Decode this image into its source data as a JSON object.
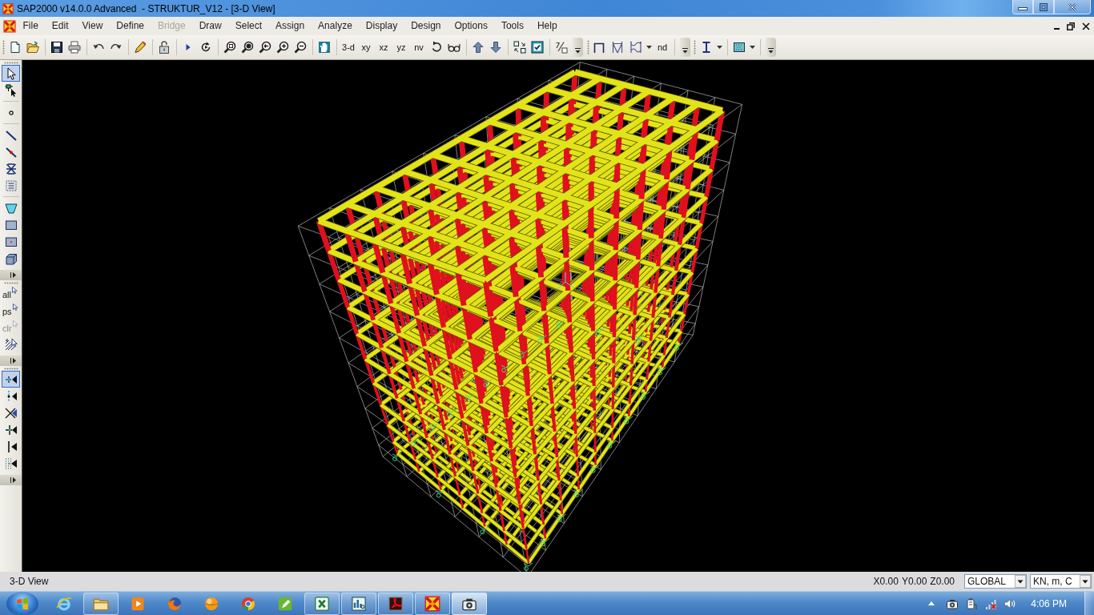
{
  "window": {
    "title": "SAP2000 v14.0.0 Advanced  - STRUKTUR_V12 - [3-D View]"
  },
  "menu": [
    {
      "label": "File",
      "disabled": false
    },
    {
      "label": "Edit",
      "disabled": false
    },
    {
      "label": "View",
      "disabled": false
    },
    {
      "label": "Define",
      "disabled": false
    },
    {
      "label": "Bridge",
      "disabled": true
    },
    {
      "label": "Draw",
      "disabled": false
    },
    {
      "label": "Select",
      "disabled": false
    },
    {
      "label": "Assign",
      "disabled": false
    },
    {
      "label": "Analyze",
      "disabled": false
    },
    {
      "label": "Display",
      "disabled": false
    },
    {
      "label": "Design",
      "disabled": false
    },
    {
      "label": "Options",
      "disabled": false
    },
    {
      "label": "Tools",
      "disabled": false
    },
    {
      "label": "Help",
      "disabled": false
    }
  ],
  "standard_toolbar": {
    "view_buttons": [
      {
        "label": "3-d"
      },
      {
        "label": "xy"
      },
      {
        "label": "xz"
      },
      {
        "label": "yz"
      },
      {
        "label": "nv"
      }
    ]
  },
  "frame_toolbar": {
    "text_buttons": [
      {
        "label": "nd"
      }
    ]
  },
  "left_toolbar": {
    "select_tools": [
      {
        "selected": true
      },
      {
        "selected": false
      }
    ],
    "select_buttons": [
      {
        "label": "all",
        "disabled": false
      },
      {
        "label": "ps",
        "disabled": false
      },
      {
        "label": "clr",
        "disabled": true
      }
    ],
    "snap_tools": [
      {
        "selected": true
      },
      {
        "selected": false
      },
      {
        "selected": false
      },
      {
        "selected": false
      },
      {
        "selected": false
      },
      {
        "selected": false
      }
    ]
  },
  "status_bar": {
    "view_name": "3-D View",
    "coordinates": [
      "X0.00",
      "Y0.00",
      "Z0.00"
    ],
    "coordinate_system": "GLOBAL",
    "units": "KN, m, C"
  },
  "taskbar": {
    "apps": [
      {
        "running": false,
        "active": false
      },
      {
        "running": true,
        "active": false
      },
      {
        "running": false,
        "active": false
      },
      {
        "running": false,
        "active": false
      },
      {
        "running": false,
        "active": false
      },
      {
        "running": false,
        "active": false
      },
      {
        "running": false,
        "active": false
      },
      {
        "running": true,
        "active": false
      },
      {
        "running": true,
        "active": false
      },
      {
        "running": true,
        "active": false
      },
      {
        "running": true,
        "active": false
      },
      {
        "running": true,
        "active": true
      }
    ],
    "clock": "4:06 PM"
  }
}
